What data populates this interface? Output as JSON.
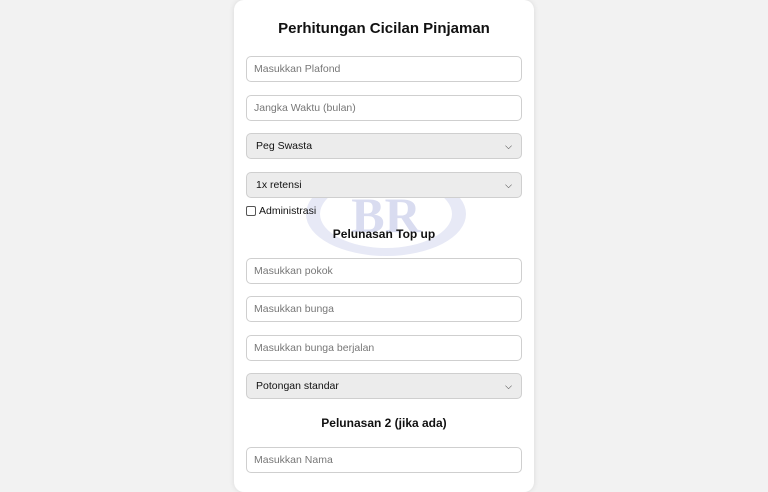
{
  "form": {
    "title": "Perhitungan Cicilan Pinjaman",
    "plafond_placeholder": "Masukkan Plafond",
    "tenor_placeholder": "Jangka Waktu (bulan)",
    "job_select_value": "Peg Swasta",
    "retention_select_value": "1x retensi",
    "admin_checkbox_label": "Administrasi",
    "admin_checked": false
  },
  "topup": {
    "heading": "Pelunasan Top up",
    "pokok_placeholder": "Masukkan pokok",
    "bunga_placeholder": "Masukkan bunga",
    "bunga_berjalan_placeholder": "Masukkan bunga berjalan",
    "potongan_select_value": "Potongan standar"
  },
  "pelunasan2": {
    "heading": "Pelunasan 2 (jika ada)",
    "nama_placeholder": "Masukkan Nama"
  },
  "watermark": {
    "logo_text": "BR"
  },
  "colors": {
    "page_background": "#f2f2f2",
    "card_background": "#ffffff",
    "select_background": "#ececec",
    "watermark": "#d9dcf0"
  }
}
